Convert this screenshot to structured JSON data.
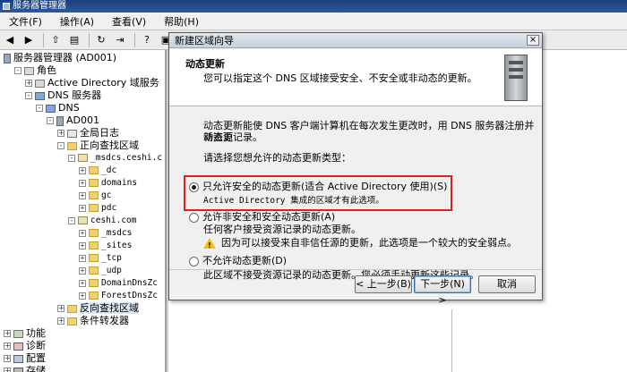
{
  "window": {
    "title": "服务器管理器"
  },
  "menu": [
    "文件(F)",
    "操作(A)",
    "查看(V)",
    "帮助(H)"
  ],
  "toolbar": [
    "back-icon",
    "forward-icon",
    "up-icon",
    "show-tree-icon",
    "refresh-icon",
    "export-icon",
    "help-icon",
    "properties-icon"
  ],
  "tree": [
    {
      "label": "服务器管理器 (AD001)",
      "depth": 0,
      "icon": "server",
      "toggle": "",
      "mono": false
    },
    {
      "label": "角色",
      "depth": 1,
      "icon": "role",
      "toggle": "-",
      "mono": false
    },
    {
      "label": "Active Directory 域服务",
      "depth": 2,
      "icon": "role",
      "toggle": "+",
      "mono": false
    },
    {
      "label": "DNS 服务器",
      "depth": 2,
      "icon": "dns",
      "toggle": "-",
      "mono": false
    },
    {
      "label": "DNS",
      "depth": 3,
      "icon": "dns",
      "toggle": "-",
      "mono": false
    },
    {
      "label": "AD001",
      "depth": 4,
      "icon": "server",
      "toggle": "-",
      "mono": false
    },
    {
      "label": "全局日志",
      "depth": 5,
      "icon": "log",
      "toggle": "+",
      "mono": false
    },
    {
      "label": "正向查找区域",
      "depth": 5,
      "icon": "folder",
      "toggle": "-",
      "mono": false
    },
    {
      "label": "_msdcs.ceshi.c",
      "depth": 6,
      "icon": "zone",
      "toggle": "-",
      "mono": true
    },
    {
      "label": "_dc",
      "depth": 7,
      "icon": "folder",
      "toggle": "+",
      "mono": true
    },
    {
      "label": "domains",
      "depth": 7,
      "icon": "folder",
      "toggle": "+",
      "mono": true
    },
    {
      "label": "gc",
      "depth": 7,
      "icon": "folder",
      "toggle": "+",
      "mono": true
    },
    {
      "label": "pdc",
      "depth": 7,
      "icon": "folder",
      "toggle": "+",
      "mono": true
    },
    {
      "label": "ceshi.com",
      "depth": 6,
      "icon": "zone",
      "toggle": "-",
      "mono": true
    },
    {
      "label": "_msdcs",
      "depth": 7,
      "icon": "folder",
      "toggle": "+",
      "mono": true
    },
    {
      "label": "_sites",
      "depth": 7,
      "icon": "folder",
      "toggle": "+",
      "mono": true
    },
    {
      "label": "_tcp",
      "depth": 7,
      "icon": "folder",
      "toggle": "+",
      "mono": true
    },
    {
      "label": "_udp",
      "depth": 7,
      "icon": "folder",
      "toggle": "+",
      "mono": true
    },
    {
      "label": "DomainDnsZc",
      "depth": 7,
      "icon": "folder",
      "toggle": "+",
      "mono": true
    },
    {
      "label": "ForestDnsZc",
      "depth": 7,
      "icon": "folder",
      "toggle": "+",
      "mono": true
    },
    {
      "label": "反向查找区域",
      "depth": 5,
      "icon": "folder",
      "toggle": "+",
      "mono": false,
      "selected": true
    },
    {
      "label": "条件转发器",
      "depth": 5,
      "icon": "folder",
      "toggle": "+",
      "mono": false
    },
    {
      "label": "功能",
      "depth": 0,
      "icon": "feature",
      "toggle": "+",
      "mono": false
    },
    {
      "label": "诊断",
      "depth": 0,
      "icon": "diag",
      "toggle": "+",
      "mono": false
    },
    {
      "label": "配置",
      "depth": 0,
      "icon": "config",
      "toggle": "+",
      "mono": false
    },
    {
      "label": "存储",
      "depth": 0,
      "icon": "storage",
      "toggle": "+",
      "mono": false
    }
  ],
  "dialog": {
    "title": "新建区域向导",
    "close": "×",
    "header_title": "动态更新",
    "header_subtitle": "您可以指定这个 DNS 区域接受安全、不安全或非动态的更新。",
    "intro_line1": "动态更新能使 DNS 客户端计算机在每次发生更改时，用 DNS 服务器注册并动态更",
    "intro_line2": "新资源记录。",
    "question": "请选择您想允许的动态更新类型：",
    "option1_label": "只允许安全的动态更新(适合 Active Directory 使用)(S)",
    "option1_note": "Active Directory 集成的区域才有此选项。",
    "option2_label": "允许非安全和安全动态更新(A)",
    "option2_note": "任何客户接受资源记录的动态更新。",
    "option2_warning": "因为可以接受来自非信任源的更新，此选项是一个较大的安全弱点。",
    "option3_label": "不允许动态更新(D)",
    "option3_note": "此区域不接受资源记录的动态更新。您必须手动更新这些记录。",
    "selected_option": 1,
    "btn_back": "< 上一步(B)",
    "btn_next": "下一步(N) >",
    "btn_cancel": "取消"
  }
}
